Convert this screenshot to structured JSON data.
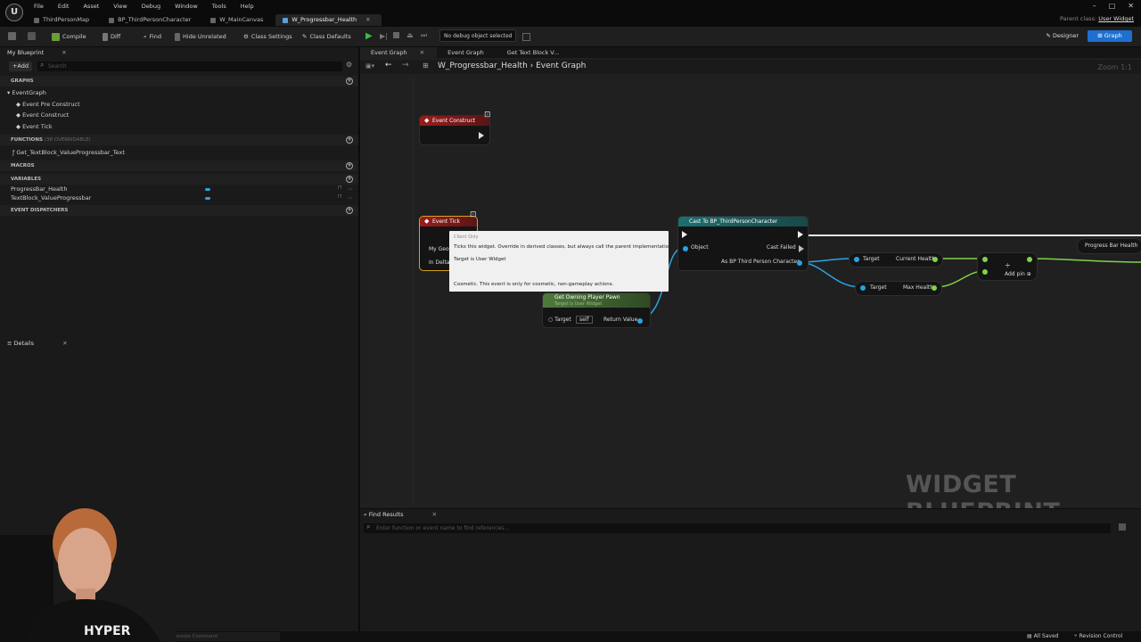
{
  "menu": [
    "File",
    "Edit",
    "Asset",
    "View",
    "Debug",
    "Window",
    "Tools",
    "Help"
  ],
  "doc_tabs": [
    {
      "label": "ThirdPersonMap"
    },
    {
      "label": "BP_ThirdPersonCharacter"
    },
    {
      "label": "W_MainCanvas"
    },
    {
      "label": "W_Progressbar_Health"
    }
  ],
  "parent_class": {
    "label": "Parent class:",
    "value": "User Widget"
  },
  "toolbar": {
    "compile": "Compile",
    "diff": "Diff",
    "find": "Find",
    "hide_unrelated": "Hide Unrelated",
    "class_settings": "Class Settings",
    "class_defaults": "Class Defaults",
    "debug_object": "No debug object selected",
    "designer": "Designer",
    "graph": "Graph"
  },
  "my_blueprint": {
    "tab": "My Blueprint",
    "add": "Add",
    "search_placeholder": "Search",
    "sections": {
      "graphs": "GRAPHS",
      "functions": "FUNCTIONS",
      "functions_note": "(38 OVERRIDABLE)",
      "macros": "MACROS",
      "variables": "VARIABLES",
      "dispatchers": "EVENT DISPATCHERS"
    },
    "graphs": [
      "EventGraph",
      "Event Pre Construct",
      "Event Construct",
      "Event Tick"
    ],
    "functions": [
      "Get_TextBlock_ValueProgressbar_Text"
    ],
    "variables": [
      "ProgressBar_Health",
      "TextBlock_ValueProgressbar"
    ]
  },
  "details": {
    "tab": "Details"
  },
  "graph_tabs": [
    "Event Graph",
    "Event Graph",
    "Get Text Block V..."
  ],
  "breadcrumb": {
    "root": "W_Progressbar_Health",
    "current": "Event Graph"
  },
  "zoom": "Zoom 1:1",
  "watermark": "WIDGET BLUEPRINT",
  "nodes": {
    "event_construct": "Event Construct",
    "event_tick": "Event Tick",
    "tick_pin_geometry": "My Geom",
    "tick_pin_delta": "In Delta",
    "cast": "Cast To BP_ThirdPersonCharacter",
    "cast_object": "Object",
    "cast_failed": "Cast Failed",
    "cast_as": "As BP Third Person Character",
    "current_health": "Current Health",
    "max_health": "Max Health",
    "target": "Target",
    "add_pin": "Add pin",
    "progress_bar_health": "Progress Bar Health",
    "owning_pawn": "Get Owning Player Pawn",
    "owning_pawn_sub": "Target is User Widget",
    "owning_target": "Target",
    "owning_self": "self",
    "return_value": "Return Value"
  },
  "tooltip": {
    "tag": "Client Only",
    "line1": "Ticks this widget.  Override in derived classes, but always call the parent implementation.",
    "line2": "Target is User Widget",
    "line3": "Cosmetic. This event is only for cosmetic, non-gameplay actions."
  },
  "find_results": {
    "tab": "Find Results",
    "placeholder": "Enter function or event name to find references..."
  },
  "status": {
    "console": "Console Command",
    "saved": "All Saved",
    "revision": "Revision Control"
  },
  "webcam_shirt": "HYPER",
  "colors": {
    "accent": "#1f6fd1",
    "event_red": "#8b1a1a",
    "cast_teal": "#1f6a6a",
    "pure_green": "#4f7a3c",
    "float_green": "#7fd34a",
    "object_blue": "#2aa3e0"
  }
}
